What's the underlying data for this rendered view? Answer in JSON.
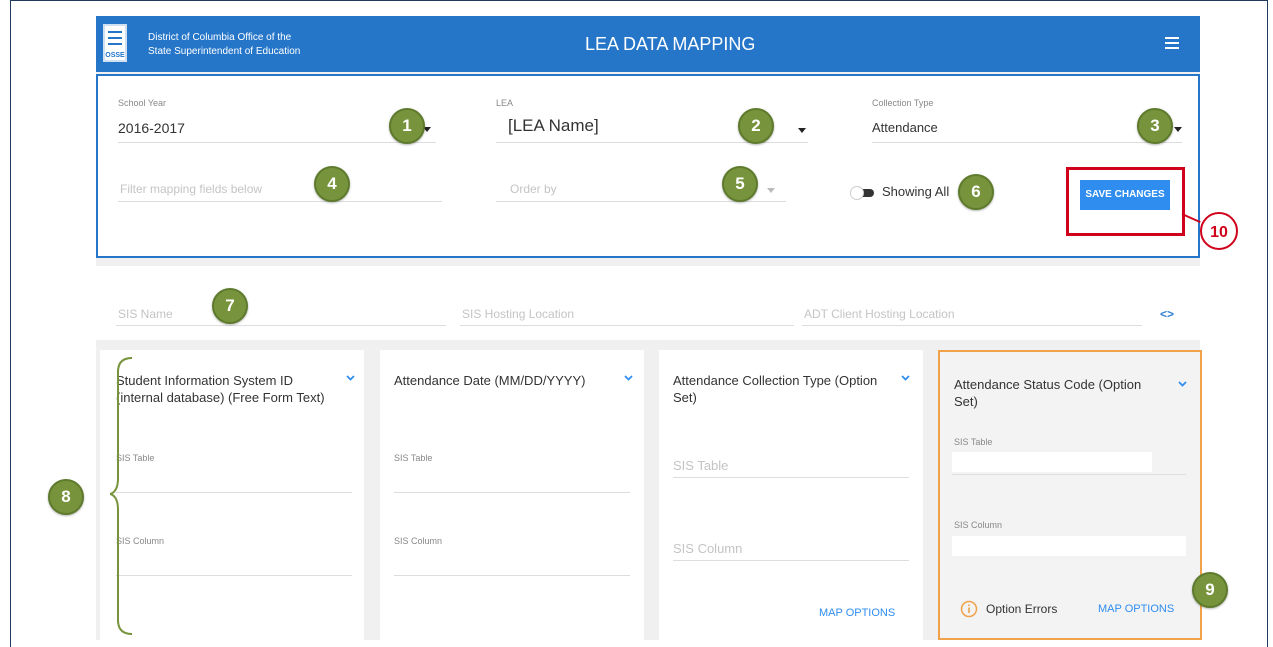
{
  "header": {
    "org_line1": "District of Columbia Office of the",
    "org_line2": "State Superintendent of Education",
    "logo_text": "OSSE",
    "title": "LEA DATA MAPPING"
  },
  "filters": {
    "school_year": {
      "label": "School Year",
      "value": "2016-2017"
    },
    "lea": {
      "label": "LEA",
      "value": "[LEA Name]"
    },
    "collection_type": {
      "label": "Collection Type",
      "value": "Attendance"
    },
    "filter_placeholder": "Filter mapping fields below",
    "order_by_placeholder": "Order by",
    "toggle_label": "Showing All",
    "save_label": "SAVE CHANGES"
  },
  "sis": {
    "name_placeholder": "SIS Name",
    "hosting_placeholder": "SIS Hosting Location",
    "adt_placeholder": "ADT Client Hosting Location",
    "code_icon": "<>"
  },
  "cards": [
    {
      "title": "Student Information System ID (internal database) (Free Form Text)",
      "table_label": "SIS Table",
      "column_label": "SIS Column"
    },
    {
      "title": "Attendance Date (MM/DD/YYYY)",
      "table_label": "SIS Table",
      "column_label": "SIS Column"
    },
    {
      "title": "Attendance Collection Type (Option Set)",
      "table_label": "SIS Table",
      "column_label": "SIS Column",
      "map_options": "MAP OPTIONS"
    },
    {
      "title": "Attendance Status Code (Option Set)",
      "table_label": "SIS Table",
      "column_label": "SIS Column",
      "errors": "Option Errors",
      "map_options": "MAP OPTIONS"
    }
  ],
  "callouts": [
    "1",
    "2",
    "3",
    "4",
    "5",
    "6",
    "7",
    "8",
    "9",
    "10"
  ],
  "colors": {
    "header": "#2576c9",
    "badge": "#77933c",
    "callout_red": "#d0021b",
    "highlight": "#f0a24a",
    "link": "#2f8df0"
  }
}
